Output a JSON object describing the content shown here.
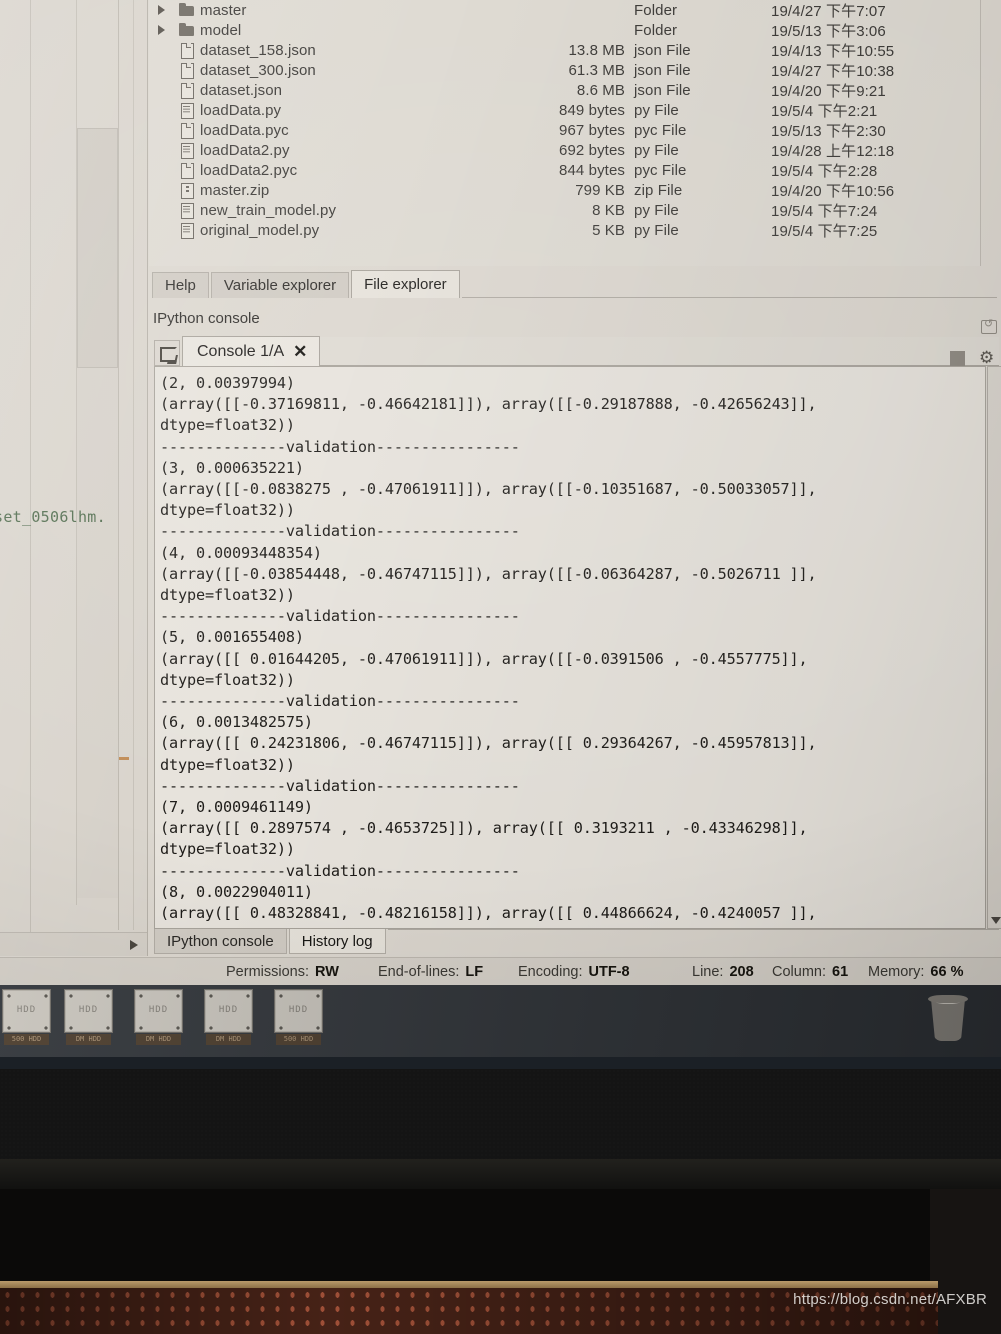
{
  "file_explorer": {
    "rows": [
      {
        "name": "master",
        "icon": "folder-icon",
        "expandable": true,
        "size": "",
        "type": "Folder",
        "date": "19/4/27 下午7:07"
      },
      {
        "name": "model",
        "icon": "folder-icon",
        "expandable": true,
        "size": "",
        "type": "Folder",
        "date": "19/5/13 下午3:06"
      },
      {
        "name": "dataset_158.json",
        "icon": "doc-icon",
        "expandable": false,
        "size": "13.8 MB",
        "type": "json File",
        "date": "19/4/13 下午10:55"
      },
      {
        "name": "dataset_300.json",
        "icon": "doc-icon",
        "expandable": false,
        "size": "61.3 MB",
        "type": "json File",
        "date": "19/4/27 下午10:38"
      },
      {
        "name": "dataset.json",
        "icon": "doc-icon",
        "expandable": false,
        "size": "8.6 MB",
        "type": "json File",
        "date": "19/4/20 下午9:21"
      },
      {
        "name": "loadData.py",
        "icon": "py-icon",
        "expandable": false,
        "size": "849 bytes",
        "type": "py File",
        "date": "19/5/4 下午2:21"
      },
      {
        "name": "loadData.pyc",
        "icon": "doc-icon",
        "expandable": false,
        "size": "967 bytes",
        "type": "pyc File",
        "date": "19/5/13 下午2:30"
      },
      {
        "name": "loadData2.py",
        "icon": "py-icon",
        "expandable": false,
        "size": "692 bytes",
        "type": "py File",
        "date": "19/4/28 上午12:18"
      },
      {
        "name": "loadData2.pyc",
        "icon": "doc-icon",
        "expandable": false,
        "size": "844 bytes",
        "type": "pyc File",
        "date": "19/5/4 下午2:28"
      },
      {
        "name": "master.zip",
        "icon": "zip-icon",
        "expandable": false,
        "size": "799 KB",
        "type": "zip File",
        "date": "19/4/20 下午10:56"
      },
      {
        "name": "new_train_model.py",
        "icon": "py-icon",
        "expandable": false,
        "size": "8 KB",
        "type": "py File",
        "date": "19/5/4 下午7:24"
      },
      {
        "name": "original_model.py",
        "icon": "py-icon",
        "expandable": false,
        "size": "5 KB",
        "type": "py File",
        "date": "19/5/4 下午7:25"
      }
    ]
  },
  "pane_tabs": [
    {
      "label": "Help",
      "active": false
    },
    {
      "label": "Variable explorer",
      "active": false
    },
    {
      "label": "File explorer",
      "active": true
    }
  ],
  "console": {
    "dock_title": "IPython console",
    "tab_label": "Console 1/A",
    "close_label": "✕",
    "gear_label": "⚙",
    "output": "(2, 0.00397994)\n(array([[-0.37169811, -0.46642181]]), array([[-0.29187888, -0.42656243]],\ndtype=float32))\n--------------validation----------------\n(3, 0.000635221)\n(array([[-0.0838275 , -0.47061911]]), array([[-0.10351687, -0.50033057]],\ndtype=float32))\n--------------validation----------------\n(4, 0.00093448354)\n(array([[-0.03854448, -0.46747115]]), array([[-0.06364287, -0.5026711 ]],\ndtype=float32))\n--------------validation----------------\n(5, 0.001655408)\n(array([[ 0.01644205, -0.47061911]]), array([[-0.0391506 , -0.4557775]],\ndtype=float32))\n--------------validation----------------\n(6, 0.0013482575)\n(array([[ 0.24231806, -0.46747115]]), array([[ 0.29364267, -0.45957813]],\ndtype=float32))\n--------------validation----------------\n(7, 0.0009461149)\n(array([[ 0.2897574 , -0.4653725]]), array([[ 0.3193211 , -0.43346298]],\ndtype=float32))\n--------------validation----------------\n(8, 0.0022904011)\n(array([[ 0.48328841, -0.48216158]]), array([[ 0.44866624, -0.4240057 ]],"
  },
  "dock_tabs": [
    {
      "label": "IPython console",
      "active": false
    },
    {
      "label": "History log",
      "active": true
    }
  ],
  "statusbar": [
    {
      "label": "Permissions:",
      "value": "RW"
    },
    {
      "label": "End-of-lines:",
      "value": "LF"
    },
    {
      "label": "Encoding:",
      "value": "UTF-8"
    },
    {
      "label": "Line:",
      "value": "208"
    },
    {
      "label": "Column:",
      "value": "61"
    },
    {
      "label": "Memory:",
      "value": "66 %"
    }
  ],
  "editor": {
    "code_fragment": "set_0506lhm."
  },
  "desktop": {
    "icons": [
      {
        "label": "HDD",
        "caption": "500 HDD"
      },
      {
        "label": "HDD",
        "caption": "DM HDD"
      },
      {
        "label": "HDD",
        "caption": "DM HDD"
      },
      {
        "label": "HDD",
        "caption": "DM HDD"
      },
      {
        "label": "HDD",
        "caption": "500 HDD"
      }
    ],
    "trash_name": "trash-icon"
  },
  "watermark": "https://blog.csdn.net/AFXBR",
  "colors": {
    "screen_bg": "#dcd7cf",
    "console_bg": "#e7e3dc",
    "tab_active": "#e6e2da",
    "tab_inactive": "#d0cbc3",
    "text": "#1d1b18",
    "code_green": "#4f6b4c",
    "desktop_bg": "#2f3338",
    "mesh_orange": "#a8543a"
  }
}
